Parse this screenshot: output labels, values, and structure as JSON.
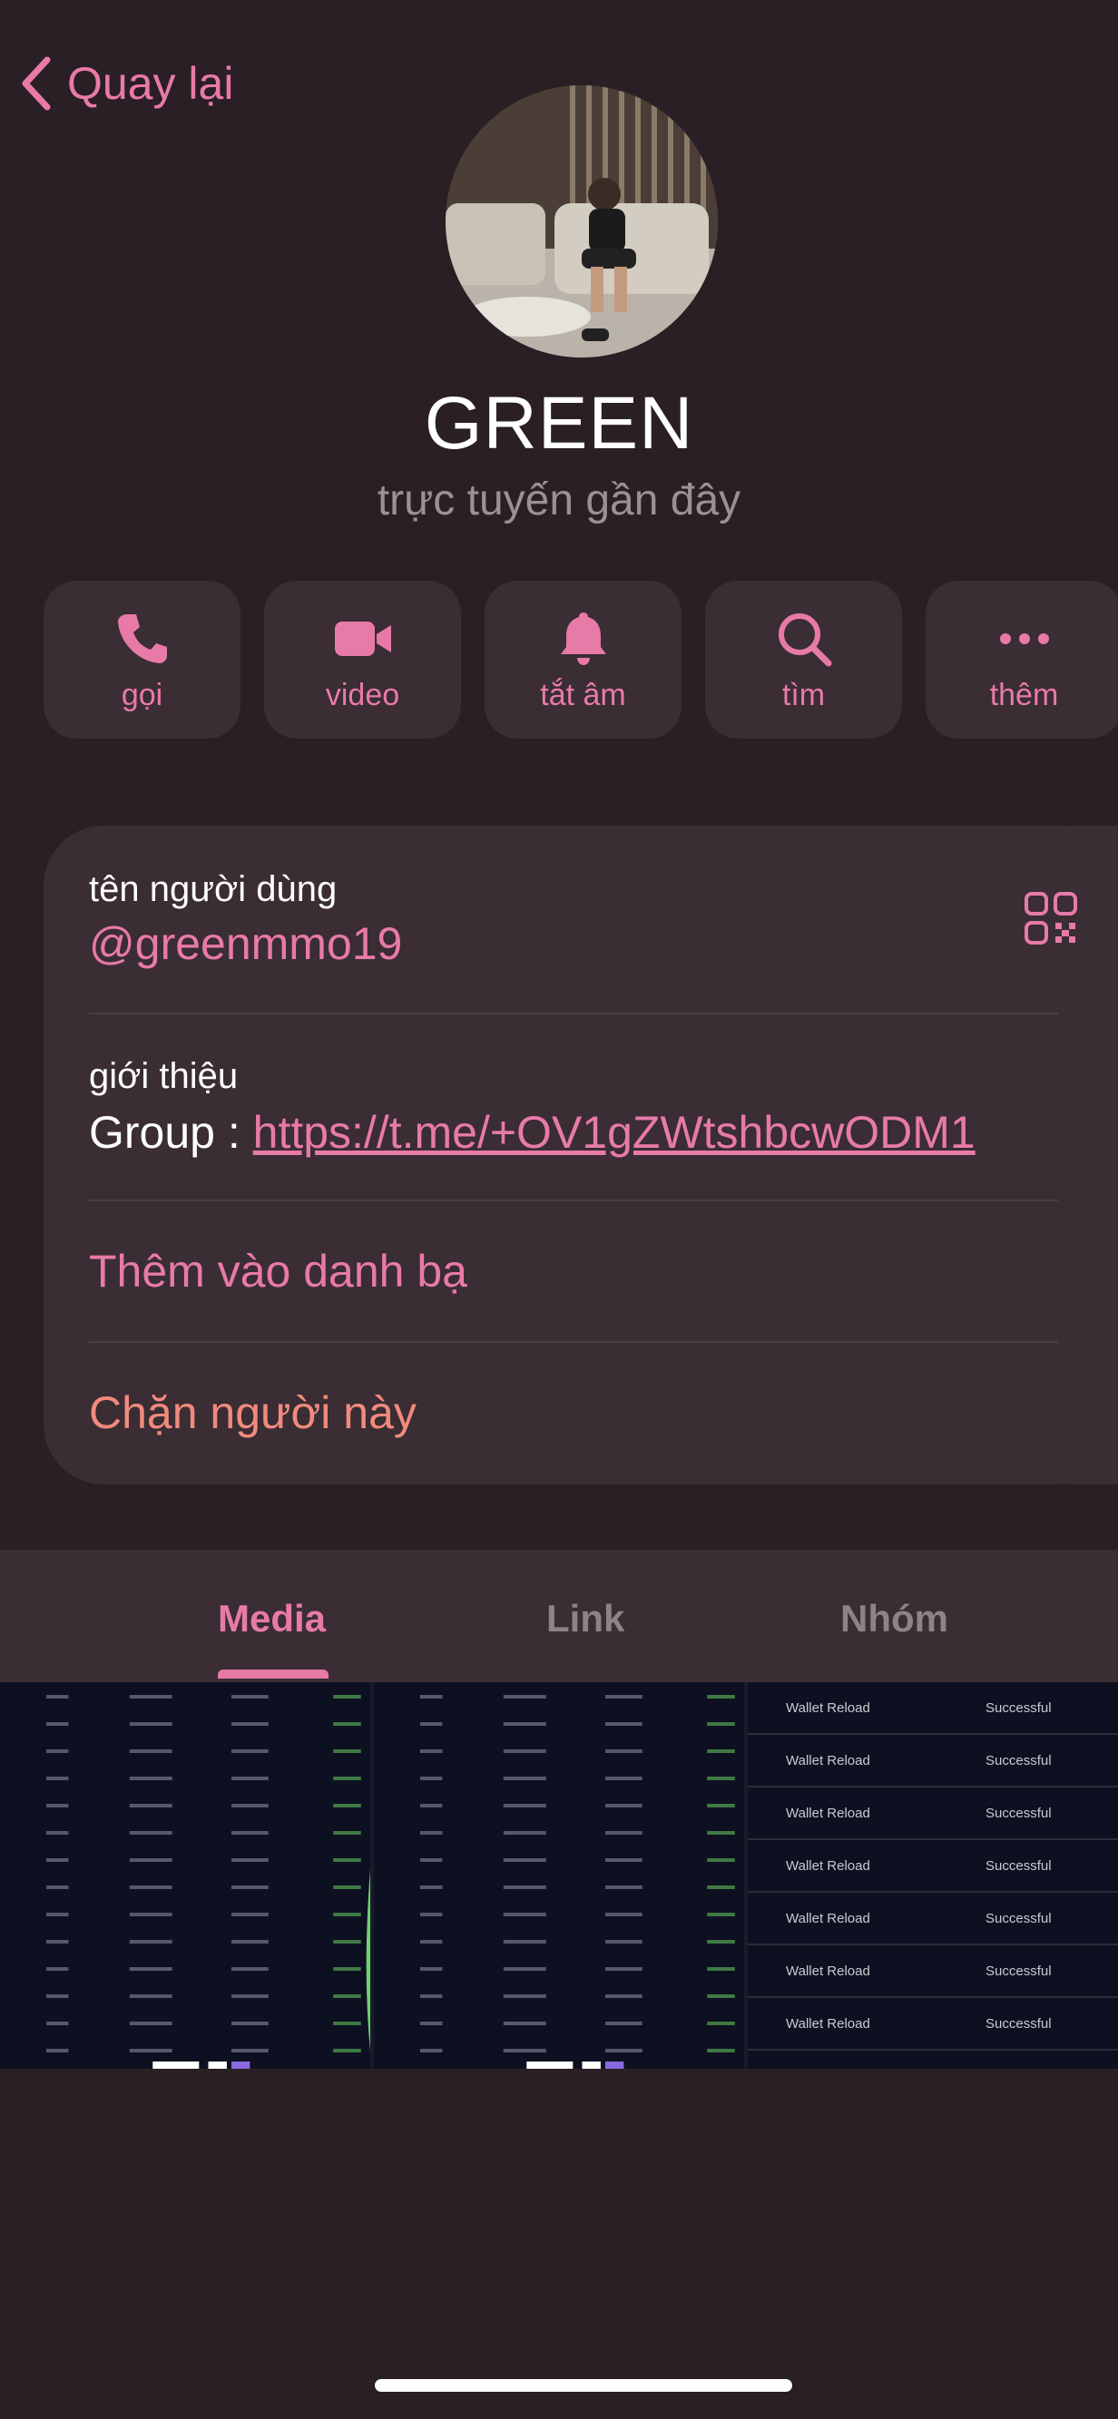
{
  "nav": {
    "back_label": "Quay lại"
  },
  "profile": {
    "name": "GREEN",
    "status": "trực tuyến gần đây"
  },
  "actions": [
    {
      "label": "gọi",
      "icon": "phone-icon"
    },
    {
      "label": "video",
      "icon": "video-camera-icon"
    },
    {
      "label": "tắt âm",
      "icon": "bell-icon"
    },
    {
      "label": "tìm",
      "icon": "search-icon"
    },
    {
      "label": "thêm",
      "icon": "more-dots-icon"
    }
  ],
  "info": {
    "username_label": "tên người dùng",
    "username": "@greenmmo19",
    "bio_label": "giới thiệu",
    "bio_prefix": "Group : ",
    "bio_link": "https://t.me/+OV1gZWtshbcwODM1",
    "add_contact": "Thêm vào danh bạ",
    "block": "Chặn người này"
  },
  "tabs": {
    "media": "Media",
    "link": "Link",
    "groups": "Nhóm",
    "active": "Media"
  },
  "media_thumb": {
    "row_type": "Wallet Reload",
    "row_status": "Successful"
  },
  "colors": {
    "accent": "#e87aa8",
    "danger": "#f28a7c",
    "background": "#2a1f24",
    "card": "#3a2d33"
  }
}
